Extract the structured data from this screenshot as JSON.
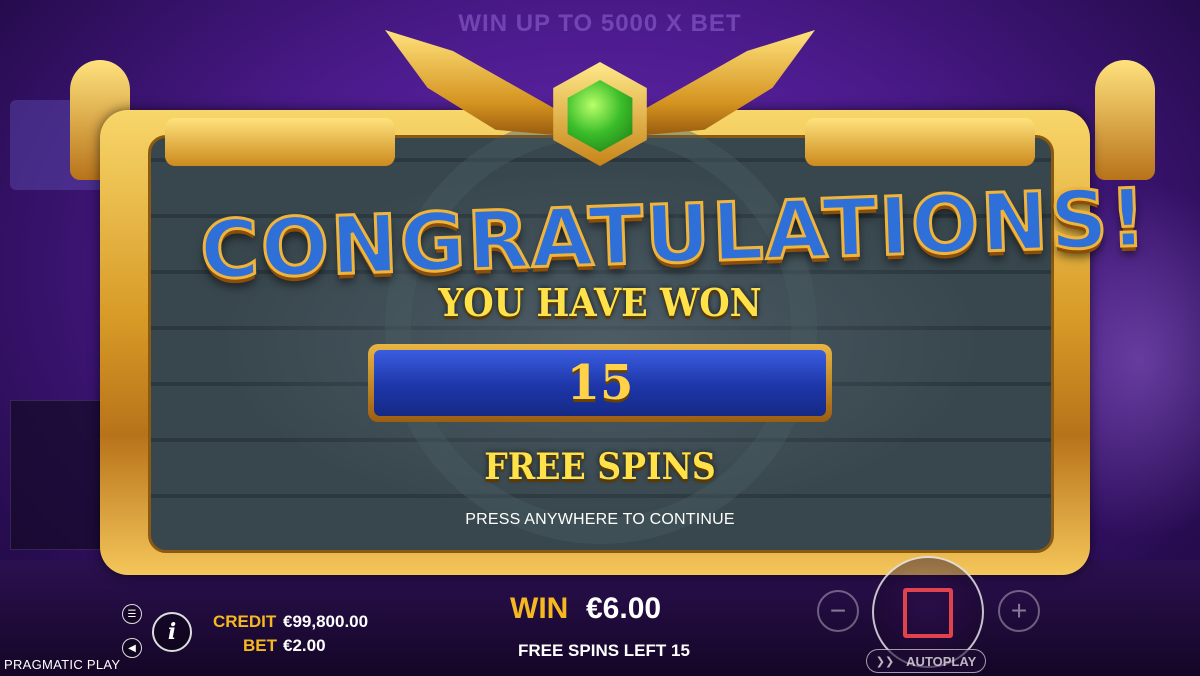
{
  "background": {
    "top_banner": "WIN UP TO 5000 X BET"
  },
  "popup": {
    "title": "CONGRATULATIONS!",
    "subtitle": "YOU HAVE WON",
    "free_spins_count": "15",
    "free_spins_label": "FREE SPINS",
    "continue_hint": "PRESS ANYWHERE TO CONTINUE"
  },
  "bottom_bar": {
    "credit_label": "CREDIT",
    "credit_value": "€99,800.00",
    "bet_label": "BET",
    "bet_value": "€2.00",
    "win_label": "WIN",
    "win_value": "€6.00",
    "free_spins_left": "FREE SPINS LEFT 15",
    "provider": "PRAGMATIC PLAY",
    "minus_label": "−",
    "plus_label": "+",
    "info_label": "i",
    "autoplay_label": "AUTOPLAY"
  },
  "icons": {
    "menu": "menu-icon",
    "sound": "sound-icon",
    "info": "info-icon",
    "stop": "stop-icon",
    "autoplay": "autoplay-icon"
  },
  "colors": {
    "gold_label": "#f5b820",
    "title_blue": "#2e6fd8",
    "stop_red": "#e0434e",
    "gem_green": "#3bbd2a"
  }
}
